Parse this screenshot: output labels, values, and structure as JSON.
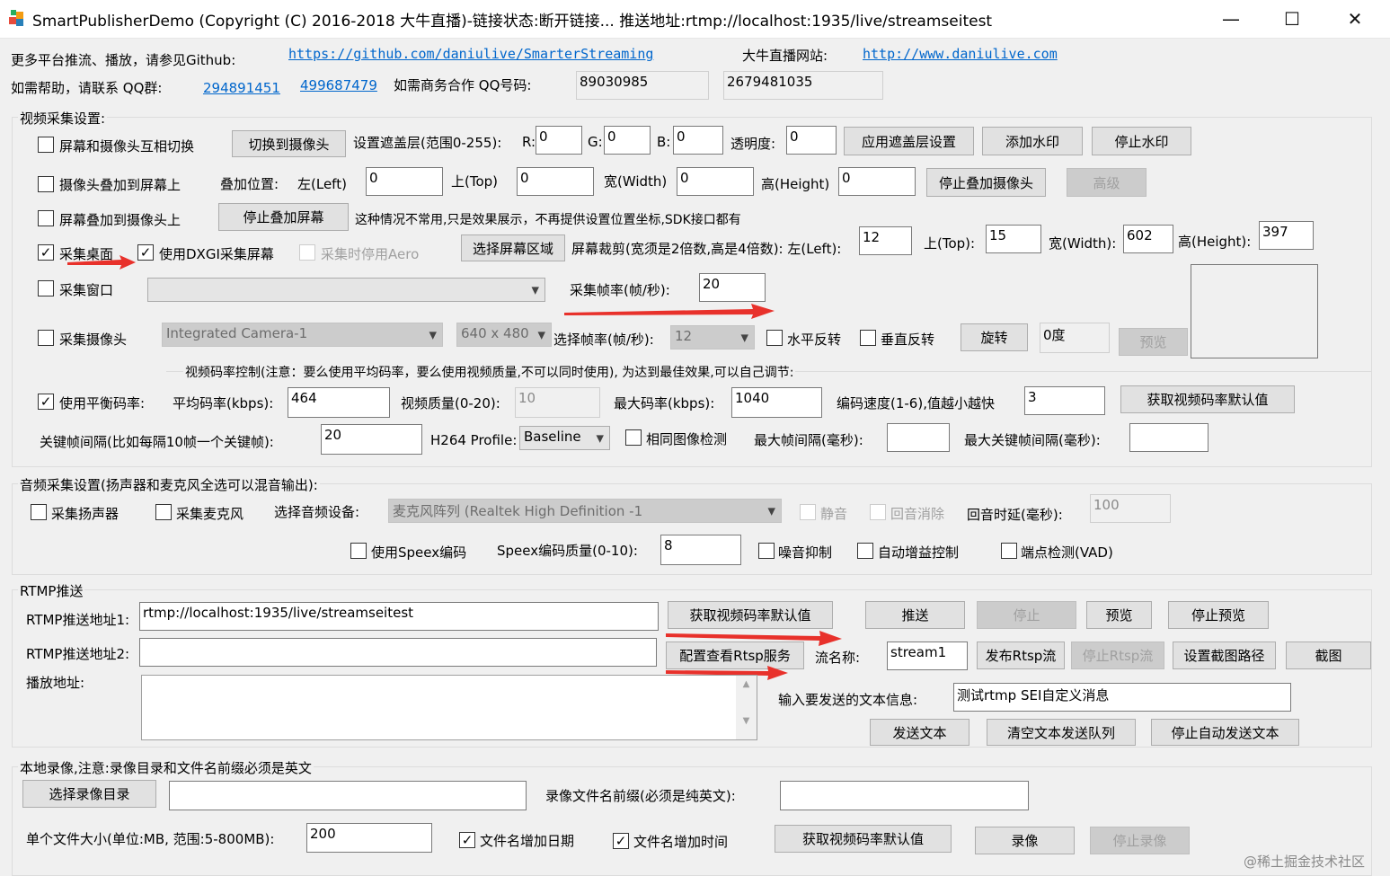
{
  "window": {
    "title": "SmartPublisherDemo  (Copyright (C) 2016-2018 大牛直播)-链接状态:断开链接... 推送地址:rtmp://localhost:1935/live/streamseitest",
    "minimize": "—",
    "maximize": "☐",
    "close": "✕"
  },
  "header": {
    "more_platforms": "更多平台推流、播放，请参见Github:",
    "github_url": "https://github.com/daniulive/SmarterStreaming",
    "site_label": "大牛直播网站:",
    "site_url": "http://www.daniulive.com",
    "help_label": "如需帮助，请联系 QQ群:",
    "qq_group1": "294891451",
    "qq_group2": "499687479",
    "biz_label": "如需商务合作 QQ号码:",
    "qq1": "89030985",
    "qq2": "2679481035"
  },
  "video": {
    "group_label": "视频采集设置:",
    "switch_cam_screen": "屏幕和摄像头互相切换",
    "switch_to_camera_btn": "切换到摄像头",
    "overlay_range_label": "设置遮盖层(范围0-255):",
    "r_label": "R:",
    "r_value": "0",
    "g_label": "G:",
    "g_value": "0",
    "b_label": "B:",
    "b_value": "0",
    "alpha_label": "透明度:",
    "alpha_value": "0",
    "apply_overlay_btn": "应用遮盖层设置",
    "add_watermark_btn": "添加水印",
    "stop_watermark_btn": "停止水印",
    "cam_over_screen": "摄像头叠加到屏幕上",
    "overlay_pos_label": "叠加位置:",
    "left_label": "左(Left)",
    "left_value": "0",
    "top_label": "上(Top)",
    "top_value": "0",
    "width_label": "宽(Width)",
    "width_value": "0",
    "height_label": "高(Height)",
    "height_value": "0",
    "stop_overlay_cam_btn": "停止叠加摄像头",
    "advanced_btn": "高级",
    "screen_over_cam": "屏幕叠加到摄像头上",
    "stop_overlay_screen_btn": "停止叠加屏幕",
    "note_text": "这种情况不常用,只是效果展示，不再提供设置位置坐标,SDK接口都有",
    "capture_desktop": "采集桌面",
    "use_dxgi": "使用DXGI采集屏幕",
    "disable_aero": "采集时停用Aero",
    "select_region_btn": "选择屏幕区域",
    "crop_label": "屏幕裁剪(宽须是2倍数,高是4倍数): 左(Left):",
    "crop_left": "12",
    "crop_top_label": "上(Top):",
    "crop_top": "15",
    "crop_width_label": "宽(Width):",
    "crop_width": "602",
    "crop_height_label": "高(Height):",
    "crop_height": "397",
    "capture_window": "采集窗口",
    "fps_label": "采集帧率(帧/秒):",
    "fps_value": "20",
    "capture_camera": "采集摄像头",
    "camera_device": "Integrated Camera-1",
    "camera_resolution": "640 x 480",
    "select_fps_label": "选择帧率(帧/秒):",
    "select_fps_value": "12",
    "hflip": "水平反转",
    "vflip": "垂直反转",
    "rotate_btn": "旋转",
    "rotate_value": "0度",
    "preview_btn": "预览",
    "bitrate_ctrl_label": "视频码率控制(注意：要么使用平均码率，要么使用视频质量,不可以同时使用), 为达到最佳效果,可以自己调节:",
    "use_avg_bitrate": "使用平衡码率:",
    "avg_bitrate_label": "平均码率(kbps):",
    "avg_bitrate": "464",
    "quality_label": "视频质量(0-20):",
    "quality": "10",
    "max_bitrate_label": "最大码率(kbps):",
    "max_bitrate": "1040",
    "speed_label": "编码速度(1-6),值越小越快",
    "speed": "3",
    "get_default_bitrate_btn": "获取视频码率默认值",
    "keyframe_label": "关键帧间隔(比如每隔10帧一个关键帧):",
    "keyframe": "20",
    "profile_label": "H264 Profile:",
    "profile": "Baseline",
    "same_image_detect": "相同图像检测",
    "max_frame_interval_label": "最大帧间隔(毫秒):",
    "max_frame_interval": "",
    "max_keyframe_interval_label": "最大关键帧间隔(毫秒):",
    "max_keyframe_interval": ""
  },
  "audio": {
    "group_label": "音频采集设置(扬声器和麦克风全选可以混音输出):",
    "capture_speaker": "采集扬声器",
    "capture_mic": "采集麦克风",
    "select_device_label": "选择音频设备:",
    "device": "麦克风阵列 (Realtek High Definition -1",
    "mute": "静音",
    "echo_cancel": "回音消除",
    "echo_delay_label": "回音时延(毫秒):",
    "echo_delay": "100",
    "use_speex": "使用Speex编码",
    "speex_quality_label": "Speex编码质量(0-10):",
    "speex_quality": "8",
    "noise_suppress": "噪音抑制",
    "agc": "自动增益控制",
    "vad": "端点检测(VAD)"
  },
  "rtmp": {
    "group_label": "RTMP推送",
    "url1_label": "RTMP推送地址1:",
    "url1": "rtmp://localhost:1935/live/streamseitest",
    "get_default_bitrate_btn": "获取视频码率默认值",
    "push_btn": "推送",
    "stop_btn": "停止",
    "preview_btn": "预览",
    "stop_preview_btn": "停止预览",
    "url2_label": "RTMP推送地址2:",
    "url2": "",
    "config_rtsp_btn": "配置查看Rtsp服务",
    "stream_name_label": "流名称:",
    "stream_name": "stream1",
    "publish_rtsp_btn": "发布Rtsp流",
    "stop_rtsp_btn": "停止Rtsp流",
    "set_snapshot_path_btn": "设置截图路径",
    "snapshot_btn": "截图",
    "play_addr_label": "播放地址:",
    "text_info_label": "输入要发送的文本信息:",
    "text_info": "测试rtmp SEI自定义消息",
    "send_text_btn": "发送文本",
    "clear_queue_btn": "清空文本发送队列",
    "stop_auto_send_btn": "停止自动发送文本"
  },
  "record": {
    "group_label": "本地录像,注意:录像目录和文件名前缀必须是英文",
    "select_dir_btn": "选择录像目录",
    "dir_value": "",
    "prefix_label": "录像文件名前缀(必须是纯英文):",
    "prefix_value": "",
    "file_size_label": "单个文件大小(单位:MB, 范围:5-800MB):",
    "file_size": "200",
    "add_date": "文件名增加日期",
    "add_time": "文件名增加时间",
    "get_default_bitrate_btn": "获取视频码率默认值",
    "record_btn": "录像",
    "stop_record_btn": "停止录像"
  },
  "watermark": "@稀土掘金技术社区"
}
